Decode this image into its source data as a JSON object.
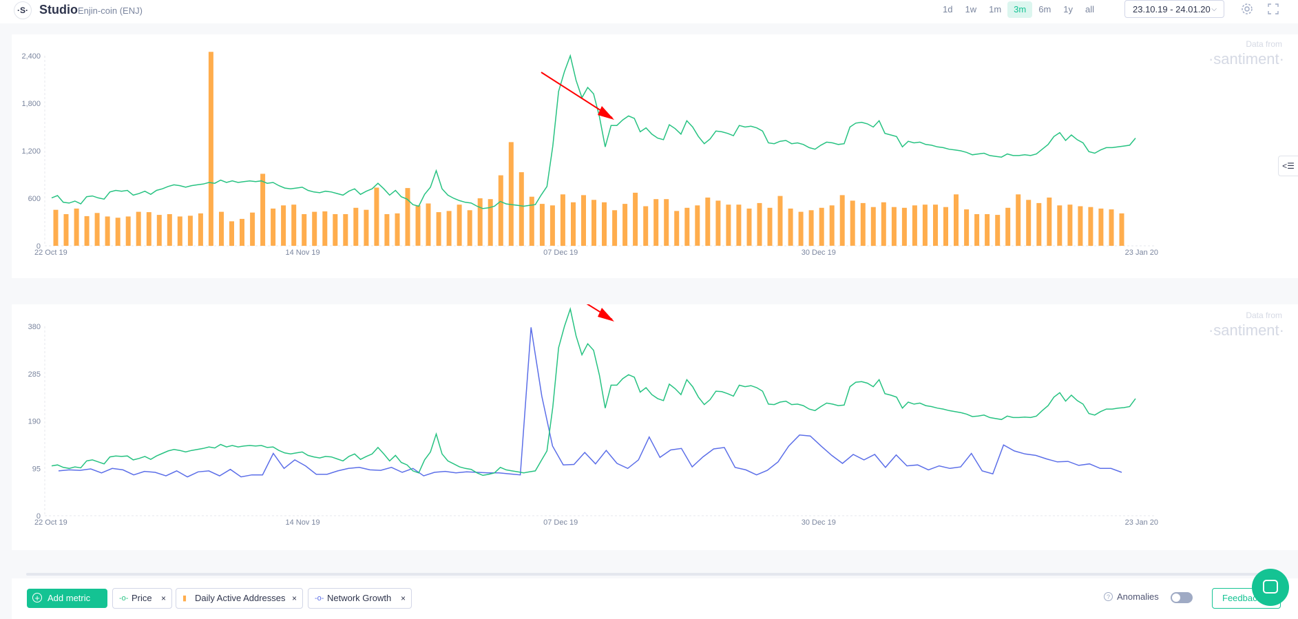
{
  "app": {
    "logo_text": "·S·",
    "title": "Studio",
    "subtitle": "Enjin-coin (ENJ)"
  },
  "header": {
    "ranges": [
      "1d",
      "1w",
      "1m",
      "3m",
      "6m",
      "1y",
      "all"
    ],
    "active_range": "3m",
    "date_range": "23.10.19 - 24.01.20",
    "icons": [
      "settings-icon",
      "fullscreen-icon"
    ]
  },
  "watermark": {
    "line1": "Data from",
    "line2": "·santiment·"
  },
  "colors": {
    "price": "#26c281",
    "daa": "#ffad4d",
    "network_growth": "#5b6ee8",
    "annotation": "#ff0000",
    "accent": "#14c393"
  },
  "chart_data": [
    {
      "type": "bar+line",
      "x_ticks": [
        "22 Oct 19",
        "14 Nov 19",
        "07 Dec 19",
        "30 Dec 19",
        "23 Jan 20"
      ],
      "y_ticks": [
        "0",
        "600",
        "1,200",
        "1,800",
        "2,400"
      ],
      "ylim": [
        0,
        2400
      ],
      "grid": false,
      "series": [
        {
          "name": "Price",
          "kind": "line",
          "values": [
            605,
            635,
            550,
            540,
            565,
            530,
            620,
            630,
            605,
            590,
            680,
            700,
            690,
            700,
            640,
            660,
            690,
            650,
            700,
            720,
            750,
            770,
            760,
            740,
            760,
            770,
            780,
            800,
            790,
            830,
            800,
            820,
            800,
            810,
            820,
            810,
            820,
            790,
            800,
            760,
            730,
            720,
            730,
            740,
            700,
            680,
            670,
            690,
            680,
            660,
            640,
            690,
            720,
            650,
            690,
            720,
            790,
            720,
            640,
            700,
            620,
            590,
            520,
            500,
            650,
            740,
            950,
            720,
            640,
            600,
            570,
            550,
            540,
            500,
            470,
            480,
            500,
            560,
            530,
            520,
            510,
            500,
            510,
            520,
            640,
            750,
            1260,
            1950,
            2200,
            2400,
            2090,
            1870,
            2000,
            1920,
            1630,
            1250,
            1520,
            1520,
            1590,
            1640,
            1610,
            1440,
            1490,
            1410,
            1360,
            1340,
            1530,
            1480,
            1410,
            1580,
            1500,
            1380,
            1290,
            1350,
            1450,
            1440,
            1420,
            1390,
            1520,
            1500,
            1510,
            1490,
            1450,
            1300,
            1290,
            1320,
            1330,
            1290,
            1300,
            1280,
            1240,
            1220,
            1270,
            1310,
            1300,
            1280,
            1290,
            1500,
            1550,
            1560,
            1540,
            1500,
            1580,
            1420,
            1400,
            1380,
            1250,
            1320,
            1300,
            1310,
            1280,
            1270,
            1250,
            1240,
            1220,
            1210,
            1200,
            1180,
            1150,
            1160,
            1170,
            1140,
            1130,
            1120,
            1160,
            1140,
            1140,
            1150,
            1140,
            1160,
            1220,
            1280,
            1380,
            1430,
            1330,
            1400,
            1340,
            1300,
            1190,
            1170,
            1210,
            1240,
            1240,
            1250,
            1260,
            1270,
            1360
          ]
        },
        {
          "name": "Daily Active Addresses",
          "kind": "bar",
          "values": [
            455,
            400,
            470,
            375,
            415,
            370,
            355,
            370,
            430,
            425,
            390,
            400,
            370,
            380,
            410,
            2450,
            430,
            310,
            340,
            420,
            910,
            470,
            510,
            520,
            400,
            430,
            435,
            400,
            400,
            480,
            455,
            735,
            400,
            410,
            730,
            510,
            535,
            425,
            440,
            520,
            450,
            600,
            590,
            890,
            1310,
            930,
            620,
            530,
            510,
            650,
            550,
            640,
            580,
            550,
            450,
            530,
            670,
            500,
            590,
            590,
            440,
            480,
            510,
            610,
            570,
            520,
            520,
            470,
            540,
            480,
            630,
            470,
            430,
            450,
            480,
            510,
            640,
            570,
            540,
            490,
            550,
            490,
            480,
            510,
            520,
            520,
            490,
            650,
            460,
            400,
            400,
            390,
            480,
            650,
            580,
            540,
            610,
            510,
            520,
            500,
            490,
            470,
            460,
            410
          ]
        }
      ]
    },
    {
      "type": "line",
      "x_ticks": [
        "22 Oct 19",
        "14 Nov 19",
        "07 Dec 19",
        "30 Dec 19",
        "23 Jan 20"
      ],
      "y_ticks": [
        "0",
        "95",
        "190",
        "285",
        "380"
      ],
      "ylim": [
        0,
        380
      ],
      "grid": false,
      "series": [
        {
          "name": "Price",
          "values": [
            100,
            102,
            97,
            95,
            98,
            96,
            110,
            112,
            108,
            104,
            118,
            120,
            119,
            120,
            112,
            115,
            119,
            113,
            120,
            125,
            130,
            133,
            131,
            128,
            131,
            133,
            135,
            138,
            136,
            143,
            138,
            141,
            138,
            140,
            141,
            140,
            141,
            137,
            138,
            131,
            126,
            124,
            126,
            128,
            121,
            118,
            116,
            119,
            118,
            114,
            110,
            119,
            124,
            113,
            119,
            124,
            137,
            124,
            110,
            121,
            107,
            102,
            90,
            86,
            112,
            128,
            164,
            124,
            110,
            104,
            98,
            95,
            93,
            86,
            81,
            83,
            86,
            97,
            92,
            90,
            88,
            86,
            88,
            90,
            110,
            130,
            218,
            337,
            380,
            415,
            361,
            323,
            345,
            332,
            282,
            216,
            262,
            262,
            275,
            283,
            278,
            248,
            257,
            243,
            235,
            231,
            264,
            255,
            243,
            273,
            259,
            238,
            223,
            233,
            250,
            249,
            245,
            240,
            262,
            259,
            261,
            257,
            250,
            224,
            223,
            228,
            230,
            223,
            224,
            221,
            214,
            211,
            219,
            226,
            224,
            221,
            222,
            259,
            268,
            269,
            266,
            259,
            273,
            245,
            242,
            238,
            216,
            228,
            224,
            226,
            221,
            219,
            216,
            214,
            211,
            209,
            207,
            204,
            199,
            200,
            202,
            197,
            195,
            193,
            200,
            197,
            197,
            198,
            197,
            200,
            211,
            221,
            238,
            247,
            230,
            242,
            231,
            224,
            205,
            202,
            209,
            214,
            214,
            216,
            217,
            219,
            235
          ]
        },
        {
          "name": "Network Growth",
          "values": [
            90,
            92,
            91,
            94,
            86,
            95,
            92,
            82,
            89,
            87,
            80,
            90,
            78,
            88,
            90,
            80,
            93,
            78,
            82,
            82,
            125,
            95,
            112,
            100,
            83,
            83,
            90,
            95,
            97,
            92,
            91,
            97,
            87,
            95,
            80,
            87,
            89,
            86,
            88,
            87,
            86,
            86,
            84,
            82,
            378,
            240,
            140,
            102,
            103,
            127,
            104,
            131,
            105,
            95,
            112,
            158,
            117,
            132,
            135,
            98,
            118,
            134,
            137,
            97,
            92,
            82,
            91,
            108,
            140,
            162,
            160,
            140,
            121,
            105,
            123,
            112,
            123,
            97,
            122,
            100,
            102,
            92,
            100,
            95,
            98,
            125,
            90,
            84,
            142,
            130,
            124,
            121,
            114,
            108,
            109,
            101,
            104,
            95,
            95,
            87
          ]
        }
      ]
    }
  ],
  "bottom_bar": {
    "add_metric": "Add metric",
    "chips": [
      {
        "label": "Price",
        "icon": "line-series-icon"
      },
      {
        "label": "Daily Active Addresses",
        "icon": "bar-series-icon"
      },
      {
        "label": "Network Growth",
        "icon": "line-series-icon"
      }
    ],
    "chip_close": "×",
    "anomalies_label": "Anomalies",
    "anomalies_enabled": false,
    "feedback": "Feedback"
  }
}
